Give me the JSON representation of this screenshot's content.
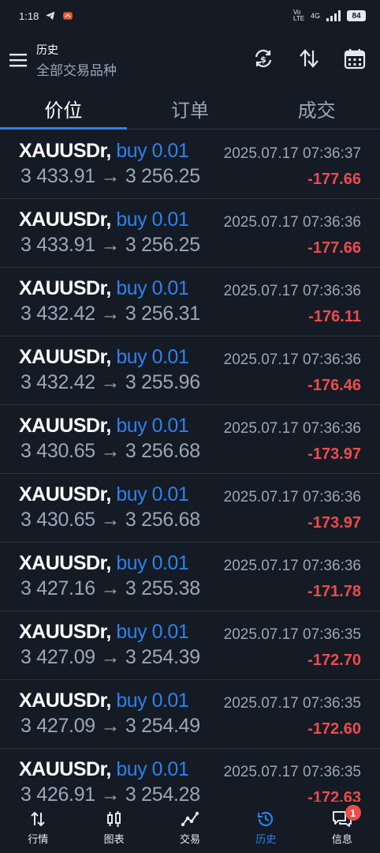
{
  "status_bar": {
    "time": "1:18",
    "network_label": "Vo LTE",
    "signal_label": "4G",
    "battery": "84"
  },
  "header": {
    "title": "历史",
    "subtitle": "全部交易品种"
  },
  "tabs": [
    {
      "label": "价位"
    },
    {
      "label": "订单"
    },
    {
      "label": "成交"
    }
  ],
  "deals": [
    {
      "symbol": "XAUUSDr,",
      "type": "buy 0.01",
      "prices": "3 433.91 → 3 256.25",
      "time": "2025.07.17 07:36:37",
      "profit": "-177.66"
    },
    {
      "symbol": "XAUUSDr,",
      "type": "buy 0.01",
      "prices": "3 433.91 → 3 256.25",
      "time": "2025.07.17 07:36:36",
      "profit": "-177.66"
    },
    {
      "symbol": "XAUUSDr,",
      "type": "buy 0.01",
      "prices": "3 432.42 → 3 256.31",
      "time": "2025.07.17 07:36:36",
      "profit": "-176.11"
    },
    {
      "symbol": "XAUUSDr,",
      "type": "buy 0.01",
      "prices": "3 432.42 → 3 255.96",
      "time": "2025.07.17 07:36:36",
      "profit": "-176.46"
    },
    {
      "symbol": "XAUUSDr,",
      "type": "buy 0.01",
      "prices": "3 430.65 → 3 256.68",
      "time": "2025.07.17 07:36:36",
      "profit": "-173.97"
    },
    {
      "symbol": "XAUUSDr,",
      "type": "buy 0.01",
      "prices": "3 430.65 → 3 256.68",
      "time": "2025.07.17 07:36:36",
      "profit": "-173.97"
    },
    {
      "symbol": "XAUUSDr,",
      "type": "buy 0.01",
      "prices": "3 427.16 → 3 255.38",
      "time": "2025.07.17 07:36:36",
      "profit": "-171.78"
    },
    {
      "symbol": "XAUUSDr,",
      "type": "buy 0.01",
      "prices": "3 427.09 → 3 254.39",
      "time": "2025.07.17 07:36:35",
      "profit": "-172.70"
    },
    {
      "symbol": "XAUUSDr,",
      "type": "buy 0.01",
      "prices": "3 427.09 → 3 254.49",
      "time": "2025.07.17 07:36:35",
      "profit": "-172.60"
    },
    {
      "symbol": "XAUUSDr,",
      "type": "buy 0.01",
      "prices": "3 426.91 → 3 254.28",
      "time": "2025.07.17 07:36:35",
      "profit": "-172.63"
    }
  ],
  "bottom_nav": [
    {
      "label": "行情",
      "icon": "quotes-icon"
    },
    {
      "label": "图表",
      "icon": "chart-icon"
    },
    {
      "label": "交易",
      "icon": "trade-icon"
    },
    {
      "label": "历史",
      "icon": "history-icon"
    },
    {
      "label": "信息",
      "icon": "messages-icon",
      "badge": "1"
    }
  ],
  "colors": {
    "background": "#141b25",
    "accent": "#2f80ed",
    "loss": "#ef4b4b",
    "muted": "#9aa7b6"
  }
}
